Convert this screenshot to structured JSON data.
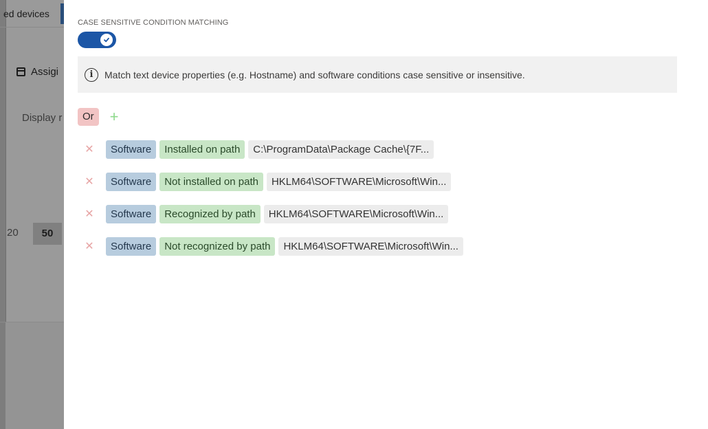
{
  "background": {
    "tab_label": "ed devices",
    "assign_label": "Assigi",
    "display_label": "Display r",
    "pager": [
      "20",
      "50"
    ]
  },
  "panel": {
    "section_label": "CASE SENSITIVE CONDITION MATCHING",
    "toggle_on": true,
    "info_text": "Match text device properties (e.g. Hostname) and software conditions case sensitive or insensitive.",
    "group_operator": "Or",
    "add_symbol": "+",
    "conditions": [
      {
        "type": "Software",
        "operator": "Installed on path",
        "value": "C:\\ProgramData\\Package Cache\\{7F..."
      },
      {
        "type": "Software",
        "operator": "Not installed on path",
        "value": "HKLM64\\SOFTWARE\\Microsoft\\Win..."
      },
      {
        "type": "Software",
        "operator": "Recognized by path",
        "value": "HKLM64\\SOFTWARE\\Microsoft\\Win..."
      },
      {
        "type": "Software",
        "operator": "Not recognized by path",
        "value": "HKLM64\\SOFTWARE\\Microsoft\\Win..."
      }
    ]
  },
  "colors": {
    "toggle": "#1c56a6",
    "operator_badge": "#f2c4c4",
    "type_tag": "#b7ccde",
    "op_tag": "#c8e6c6",
    "value_tag": "#ececec",
    "delete": "#e7a5a5",
    "add": "#8ed98c"
  },
  "icons": {
    "info": "info-icon",
    "delete": "close-icon",
    "add": "plus-icon",
    "calendar": "calendar-icon",
    "toggle_check": "check-icon"
  }
}
